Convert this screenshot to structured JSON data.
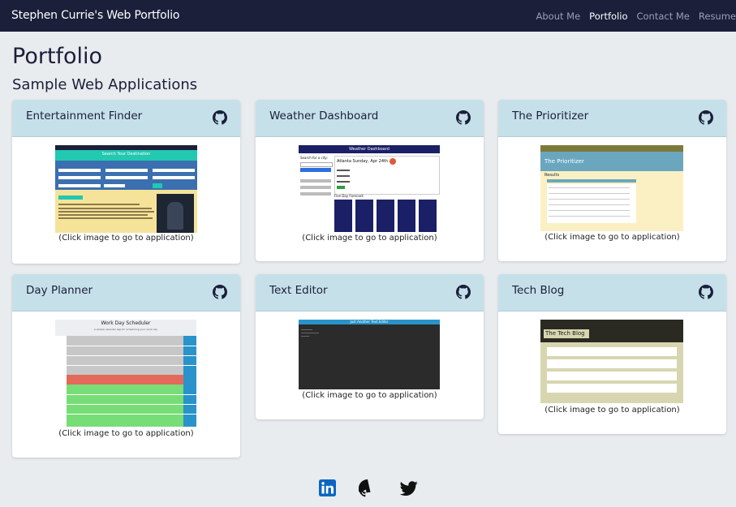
{
  "nav": {
    "brand": "Stephen Currie's Web Portfolio",
    "links": [
      "About Me",
      "Portfolio",
      "Contact Me",
      "Resume"
    ],
    "active": "Portfolio"
  },
  "page": {
    "title": "Portfolio",
    "subtitle": "Sample Web Applications"
  },
  "caption": "(Click image to go to application)",
  "projects": [
    {
      "title": "Entertainment Finder",
      "thumb_heading": "Search Your Destination",
      "thumb_button": "Search",
      "icon": "github-icon"
    },
    {
      "title": "Weather Dashboard",
      "thumb_heading": "Weather Dashboard",
      "thumb_city": "Atlanta Sunday, Apr 24th",
      "thumb_search": "Search for a city:",
      "thumb_forecast": "Five Day Forecast:",
      "icon": "github-icon"
    },
    {
      "title": "The Prioritizer",
      "thumb_heading": "The Prioritizer",
      "thumb_section": "Results",
      "icon": "github-icon"
    },
    {
      "title": "Day Planner",
      "thumb_heading": "Work Day Scheduler",
      "thumb_sub": "A simple calendar app for scheduling your work day",
      "icon": "github-icon"
    },
    {
      "title": "Text Editor",
      "thumb_heading": "Just Another Text Editor",
      "icon": "github-icon"
    },
    {
      "title": "Tech Blog",
      "thumb_heading": "The Tech Blog",
      "icon": "github-icon"
    }
  ],
  "footer": {
    "icons": [
      "linkedin-icon",
      "github-icon",
      "twitter-icon"
    ]
  },
  "colors": {
    "navbar": "#1b1f3a",
    "card_header": "#c6e0ea",
    "background": "#e8ecef",
    "linkedin": "#0a66c2"
  }
}
